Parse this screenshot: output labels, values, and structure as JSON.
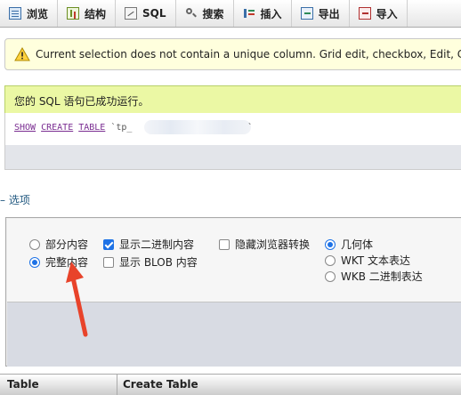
{
  "tabs": [
    {
      "label": "浏览",
      "icon": "browse-icon"
    },
    {
      "label": "结构",
      "icon": "structure-icon"
    },
    {
      "label": "SQL",
      "icon": "sql-icon"
    },
    {
      "label": "搜索",
      "icon": "search-icon"
    },
    {
      "label": "插入",
      "icon": "insert-icon"
    },
    {
      "label": "导出",
      "icon": "export-icon"
    },
    {
      "label": "导入",
      "icon": "import-icon"
    }
  ],
  "notice": {
    "text": "Current selection does not contain a unique column. Grid edit, checkbox, Edit, Co",
    "icon": "warning-icon"
  },
  "result": {
    "success_text": "您的 SQL 语句已成功运行。",
    "sql": {
      "kw1": "SHOW",
      "kw2": "CREATE",
      "kw3": "TABLE",
      "table": "`tp_",
      "tail": "`"
    }
  },
  "options": {
    "toggle_label": "– 选项",
    "partial_text": "部分内容",
    "full_text": "完整内容",
    "show_binary": "显示二进制内容",
    "show_blob": "显示 BLOB 内容",
    "hide_transform": "隐藏浏览器转换",
    "geometry": "几何体",
    "wkt": "WKT 文本表达",
    "wkb": "WKB 二进制表达"
  },
  "state": {
    "text_mode": "full",
    "show_binary": true,
    "show_blob": false,
    "hide_transform": false,
    "geometry_mode": "geometry"
  },
  "table": {
    "columns": [
      "Table",
      "Create Table"
    ]
  },
  "colors": {
    "accent": "#1e72e6",
    "success_bg": "#ebf8a4",
    "notice_bg": "#ffffdd",
    "annotation": "#e8432a"
  }
}
